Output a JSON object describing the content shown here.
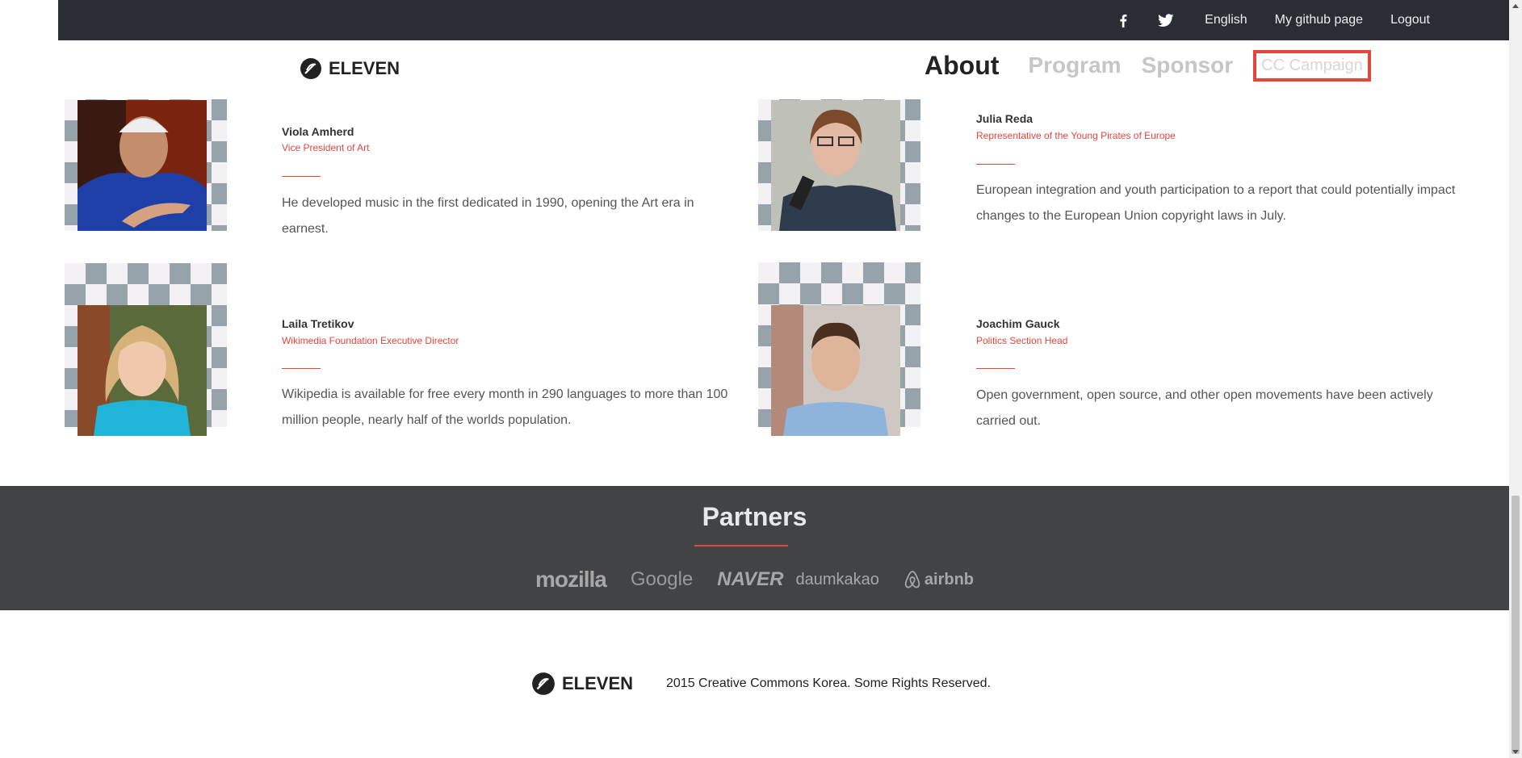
{
  "topbar": {
    "facebook_icon": "facebook-icon",
    "twitter_icon": "twitter-icon",
    "language": "English",
    "github": "My github page",
    "logout": "Logout"
  },
  "header": {
    "logo_text": "ELEVEN",
    "nav": {
      "about": "About",
      "program": "Program",
      "sponsor": "Sponsor",
      "cc_campaign": "CC Campaign"
    }
  },
  "people": [
    {
      "name": "Viola Amherd",
      "role": "Vice President of Art",
      "desc": "He developed music in the first dedicated in 1990, opening the Art era in earnest."
    },
    {
      "name": "Julia Reda",
      "role": "Representative of the Young Pirates of Europe",
      "desc": "European integration and youth participation to a report that could potentially impact changes to the European Union copyright laws in July."
    },
    {
      "name": "Laila Tretikov",
      "role": "Wikimedia Foundation Executive Director",
      "desc": "Wikipedia is available for free every month in 290 languages to more than 100 million people, nearly half of the worlds population."
    },
    {
      "name": "Joachim Gauck",
      "role": "Politics Section Head",
      "desc": "Open government, open source, and other open movements have been actively carried out."
    }
  ],
  "partners": {
    "title": "Partners",
    "logos": [
      "mozilla",
      "Google",
      "NAVER",
      "daumkakao",
      "airbnb"
    ]
  },
  "footer": {
    "logo_text": "ELEVEN",
    "copyright": "2015 Creative Commons Korea. Some Rights Reserved."
  },
  "colors": {
    "accent": "#e4463c",
    "topbar": "#2b2d35",
    "partners_bg": "#424345"
  }
}
